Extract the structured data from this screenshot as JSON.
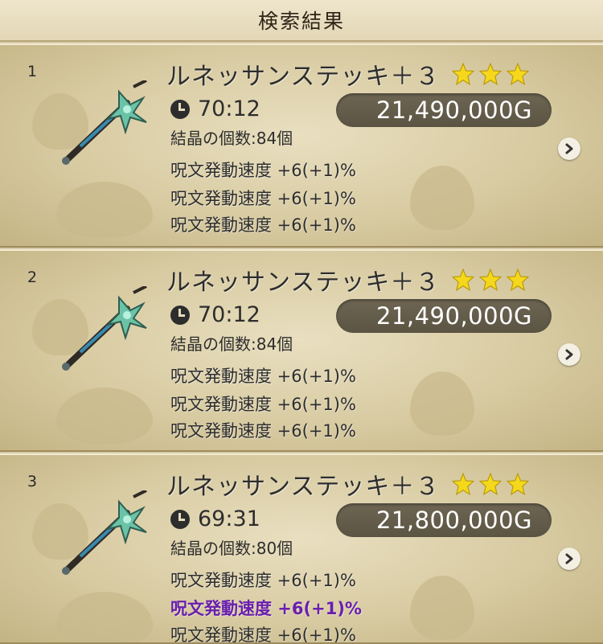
{
  "header": {
    "title": "検索結果"
  },
  "results": [
    {
      "rank": "1",
      "name": "ルネッサンステッキ＋３",
      "stars": 3,
      "time": "70:12",
      "price": "21,490,000G",
      "crystal": "結晶の個数:84個",
      "stats": [
        "呪文発動速度  +6(+1)%",
        "呪文発動速度  +6(+1)%",
        "呪文発動速度  +6(+1)%"
      ]
    },
    {
      "rank": "2",
      "name": "ルネッサンステッキ＋３",
      "stars": 3,
      "time": "70:12",
      "price": "21,490,000G",
      "crystal": "結晶の個数:84個",
      "stats": [
        "呪文発動速度  +6(+1)%",
        "呪文発動速度  +6(+1)%",
        "呪文発動速度  +6(+1)%"
      ]
    },
    {
      "rank": "3",
      "name": "ルネッサンステッキ＋３",
      "stars": 3,
      "time": "69:31",
      "price": "21,800,000G",
      "crystal": "結晶の個数:80個",
      "stats": [
        "呪文発動速度  +6(+1)%",
        "呪文発動速度  +6(+1)%",
        "呪文発動速度  +6(+1)%"
      ]
    }
  ],
  "colors": {
    "star": "#f5d81c",
    "highlight_stat": "#6a1fae",
    "price_pill": "#625a48",
    "panel": "#d8cba2"
  },
  "icons": {
    "clock": "clock-icon",
    "star": "star-icon",
    "arrow": "chevron-right-icon",
    "weapon": "staff-icon"
  }
}
